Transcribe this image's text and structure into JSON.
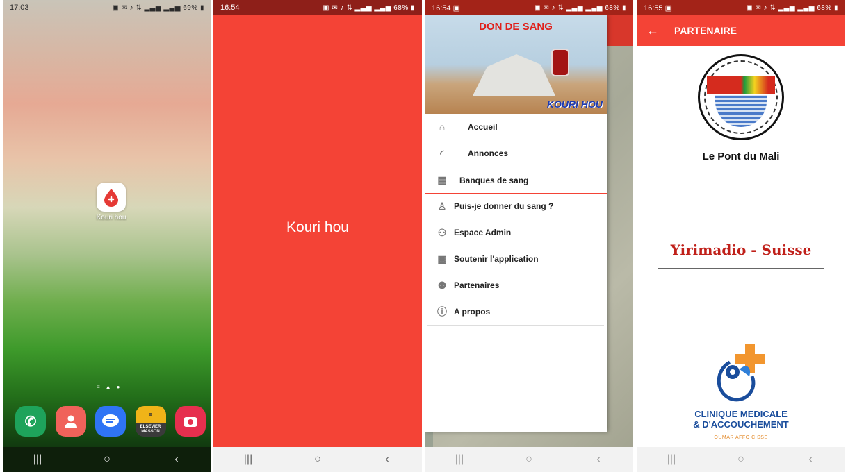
{
  "screen1": {
    "time": "17:03",
    "status_right": "69%",
    "app_label": "Kouri hou",
    "dock": [
      {
        "name": "phone",
        "color": "#1ea35b"
      },
      {
        "name": "contacts",
        "color": "#f0625a"
      },
      {
        "name": "messages",
        "color": "#2f74f5"
      },
      {
        "name": "therapeutique",
        "color": "#f0b418"
      },
      {
        "name": "camera",
        "color": "#e62f4e"
      }
    ],
    "dock_app_text": "ELSEVIER MASSON"
  },
  "screen2": {
    "time": "16:54",
    "status_right": "68%",
    "splash_title": "Kouri hou"
  },
  "screen3": {
    "time": "16:54",
    "status_right": "68%",
    "header_title": "DON DE SANG",
    "header_subtitle": "KOURI HOU",
    "menu": [
      {
        "label": "Accueil",
        "icon": "home-icon"
      },
      {
        "label": "Annonces",
        "icon": "rss-icon"
      },
      {
        "label": "Banques de sang",
        "icon": "building-icon"
      },
      {
        "label": "Puis-je donner du sang ?",
        "icon": "person-question-icon"
      },
      {
        "label": "Espace Admin",
        "icon": "admin-group-icon"
      },
      {
        "label": "Soutenir l'application",
        "icon": "support-icon"
      },
      {
        "label": "Partenaires",
        "icon": "people-icon"
      },
      {
        "label": "A propos",
        "icon": "info-icon"
      }
    ]
  },
  "screen4": {
    "time": "16:55",
    "status_right": "68%",
    "appbar_title": "PARTENAIRE",
    "partner1": "Le Pont du Mali",
    "partner2": "Yirimadio - Suisse",
    "clinic_line1": "CLINIQUE MEDICALE",
    "clinic_line2": "& D'ACCOUCHEMENT",
    "clinic_sub": "OUMAR AFFO CISSE"
  }
}
